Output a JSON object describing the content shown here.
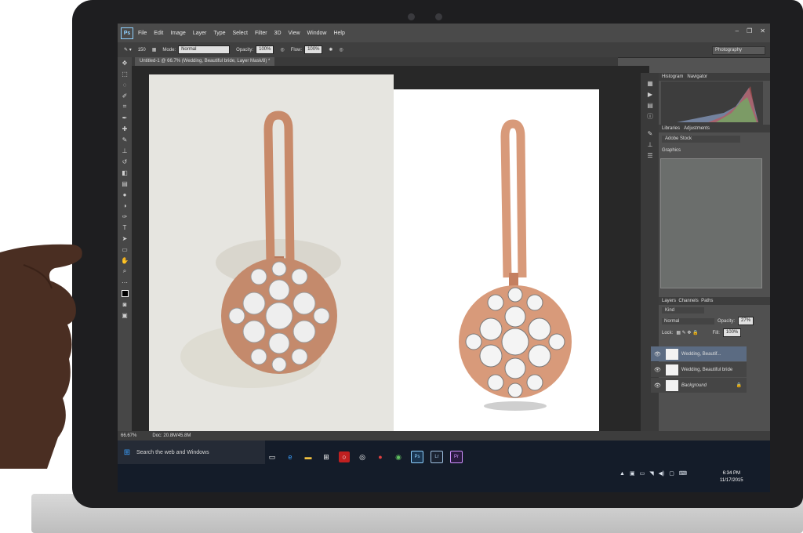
{
  "photoshop": {
    "logo": "Ps",
    "menu": [
      "File",
      "Edit",
      "Image",
      "Layer",
      "Type",
      "Select",
      "Filter",
      "3D",
      "View",
      "Window",
      "Help"
    ],
    "options": {
      "brush_size": "150",
      "mode_label": "Mode:",
      "mode_value": "Normal",
      "opacity_label": "Opacity:",
      "opacity_value": "100%",
      "flow_label": "Flow:",
      "flow_value": "100%"
    },
    "workspace_preset": "Photography",
    "document_tab": "Untitled-1 @ 66.7% (Wedding, Beautiful bride, Layer Mask/8) *",
    "panels": {
      "histogram_tabs": [
        "Histogram",
        "Navigator"
      ],
      "library_tabs": [
        "Libraries",
        "Adjustments"
      ],
      "library_source": "Adobe Stock",
      "library_group": "Graphics",
      "layer_tabs": [
        "Layers",
        "Channels",
        "Paths"
      ],
      "layer_filter": "Kind",
      "blend_mode": "Normal",
      "opacity_label": "Opacity:",
      "opacity_value": "27%",
      "lock_label": "Lock:",
      "fill_label": "Fill:",
      "fill_value": "100%",
      "layers": [
        "Wedding, Beautif...",
        "Wedding, Beautiful bride",
        "Background"
      ]
    },
    "status": {
      "zoom": "66.67%",
      "doc": "Doc: 20.8M/45.8M"
    }
  },
  "taskbar": {
    "search_placeholder": "Search the web and Windows",
    "apps": [
      "Lr",
      "Pr",
      "Ps"
    ],
    "time": "6:34 PM",
    "date": "11/17/2015"
  },
  "colors": {
    "ps_accent": "#8fd1ff",
    "taskbar": "#141c29",
    "rose_gold": "#d89a7a"
  }
}
